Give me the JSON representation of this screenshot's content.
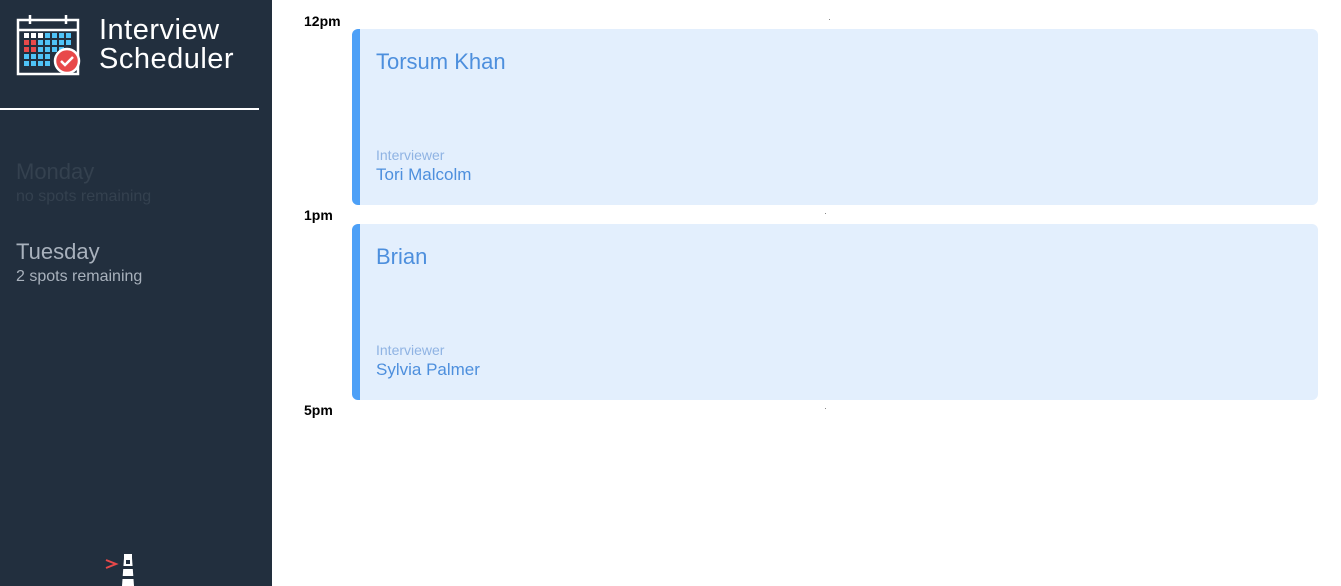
{
  "app": {
    "title_line1": "Interview",
    "title_line2": "Scheduler",
    "logo_icon": "calendar-check-icon",
    "footer_icon": "lighthouse-icon"
  },
  "sidebar": {
    "days": [
      {
        "name": "Monday",
        "spots": "no spots remaining",
        "state": "full"
      },
      {
        "name": "Tuesday",
        "spots": "2 spots remaining",
        "state": "available"
      }
    ]
  },
  "schedule": {
    "times": [
      "12pm",
      "1pm",
      "5pm"
    ],
    "appointments": [
      {
        "student": "Torsum Khan",
        "interviewer_label": "Interviewer",
        "interviewer": "Tori Malcolm"
      },
      {
        "student": "Brian",
        "interviewer_label": "Interviewer",
        "interviewer": "Sylvia Palmer"
      }
    ]
  },
  "colors": {
    "sidebar_bg": "#222f3e",
    "appointment_bg": "#e3effd",
    "appointment_accent": "#4da0f7",
    "appointment_text": "#4d8fdd",
    "check_badge": "#e8494a"
  }
}
